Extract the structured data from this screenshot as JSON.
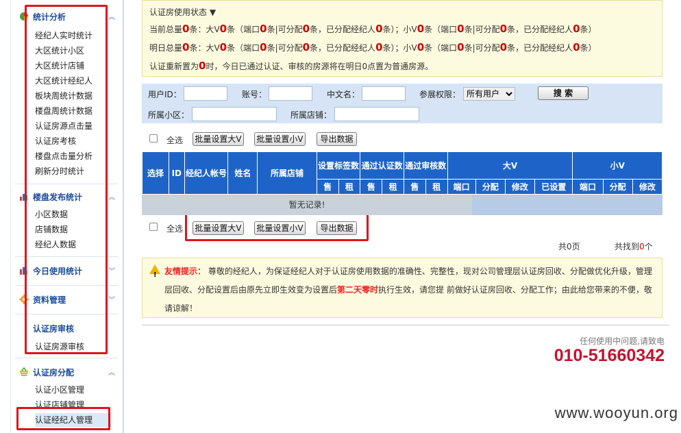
{
  "sidebar": {
    "sections": [
      {
        "title": "统计分析",
        "icon": "pie-chart-icon",
        "items": [
          "经纪人实时统计",
          "大区统计小区",
          "大区统计店铺",
          "大区统计经纪人",
          "板块周统计数据",
          "楼盘周统计数据",
          "认证房源点击量",
          "认证房考核",
          "楼盘点击量分析",
          "刷新分时统计"
        ]
      },
      {
        "title": "楼盘发布统计",
        "icon": "bar-chart-icon",
        "items": [
          "小区数据",
          "店铺数据",
          "经纪人数据"
        ]
      },
      {
        "title": "今日使用统计",
        "icon": "bar-chart-icon",
        "items": []
      },
      {
        "title": "资料管理",
        "icon": "gear-icon",
        "items": []
      },
      {
        "title": "认证房审核",
        "icon": "",
        "items": [
          "认证房源审核"
        ]
      },
      {
        "title": "认证房分配",
        "icon": "basket-icon",
        "items": [
          "认证小区管理",
          "认证店铺管理",
          "认证经纪人管理"
        ]
      }
    ]
  },
  "notice": {
    "title": "认证房使用状态 ▼",
    "today": {
      "p1": "当前总量",
      "n1": "0",
      "p2": "条：大V",
      "n2": "0",
      "p3": "条（端口",
      "n3": "0",
      "p4": "条|可分配",
      "n4": "0",
      "p5": "条，已分配经纪人",
      "n5": "0",
      "p6": "条）；小V",
      "n6": "0",
      "p7": "条（端口",
      "n7": "0",
      "p8": "条|可分配",
      "n8": "0",
      "p9": "条，已分配经纪人",
      "n9": "0",
      "p10": "条）"
    },
    "tomorrow": {
      "p1": "明日总量",
      "n1": "0",
      "p2": "条：大V",
      "n2": "0",
      "p3": "条（端口",
      "n3": "0",
      "p4": "条|可分配",
      "n4": "0",
      "p5": "条，已分配经纪人",
      "n5": "0",
      "p6": "条）；小V",
      "n6": "0",
      "p7": "条（端口",
      "n7": "0",
      "p8": "条|可分配",
      "n8": "0",
      "p9": "条，已分配经纪人",
      "n9": "0",
      "p10": "条）"
    },
    "reset": {
      "p1": "认证重新置为",
      "n1": "0",
      "p2": "时，今日已通过认证、审核的房源将在明日0点置为普通房源。"
    }
  },
  "search": {
    "user_id_label": "用户ID：",
    "account_label": "账号：",
    "cn_name_label": "中文名：",
    "permission_label": "参展权限：",
    "permission_value": "所有用户",
    "search_button": "搜 索",
    "community_label": "所属小区：",
    "store_label": "所属店铺："
  },
  "toolbar": {
    "select_all": "全选",
    "batch_big_v": "批量设置大V",
    "batch_small_v": "批量设置小V",
    "export": "导出数据"
  },
  "table": {
    "headers": {
      "select": "选择",
      "id": "ID",
      "agent_account": "经纪人帐号",
      "name": "姓名",
      "store": "所属店铺",
      "set_sign": "设置标签数",
      "pass_cert": "通过认证数",
      "pass_audit": "通过审核数",
      "big_v": "大V",
      "small_v": "小V",
      "sale": "售",
      "rent": "租",
      "port": "端口",
      "assign": "分配",
      "modify": "修改",
      "configured": "已设置"
    },
    "empty_text": "暂无记录!"
  },
  "pager": {
    "pages_prefix": "共",
    "pages": "0",
    "pages_suffix": "页",
    "found_prefix": "共找到",
    "found": "0",
    "found_suffix": "个"
  },
  "tip": {
    "label": "友情提示：",
    "text1": "尊敬的经纪人，为保证经纪人对于认证房使用数据的准确性、完整性，现对公司管理层认证房回收、分配做优化升级，管理层回收、分配设置后由原先立即生效变为设置后",
    "highlight": "第二天零时",
    "text2": "执行生效，请您提 前做好认证房回收、分配工作；由此给您带来的不便，敬请谅解！"
  },
  "contact": {
    "label": "任何使用中问题,请致电",
    "phone": "010-51660342"
  },
  "watermark": "www.wooyun.org",
  "colors": {
    "header_blue": "#1e64c8",
    "accent_red": "#d00000",
    "highlight_box": "#e0131b"
  }
}
